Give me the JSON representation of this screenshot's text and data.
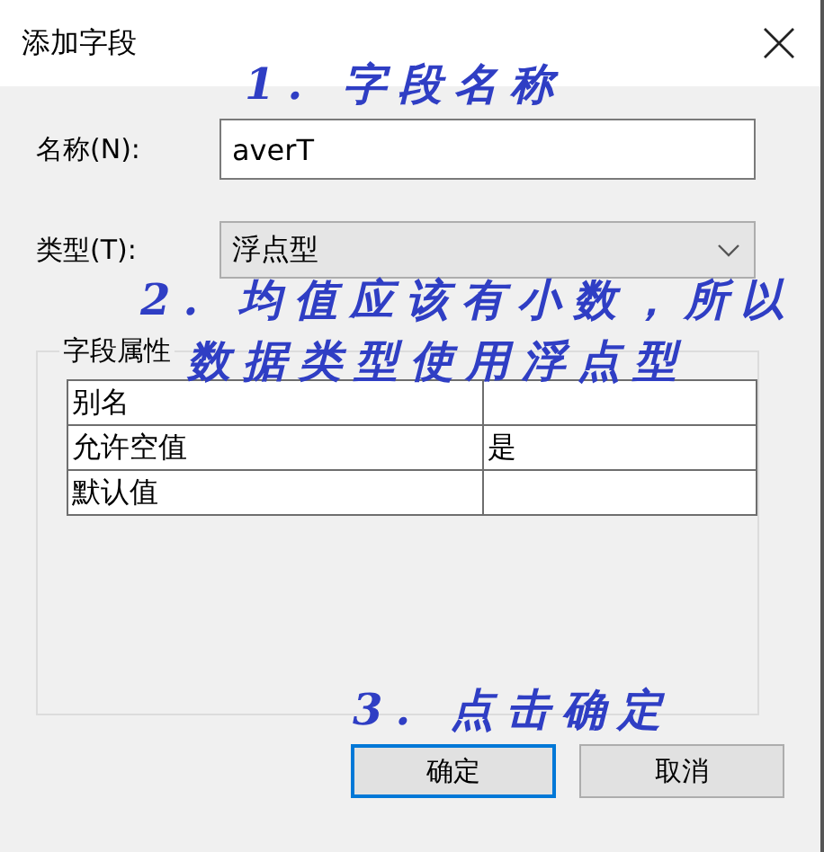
{
  "window": {
    "title": "添加字段"
  },
  "fields": [
    {
      "kind": "text",
      "label": "名称(N):",
      "value": "averT"
    },
    {
      "kind": "dropdown",
      "label": "类型(T):",
      "value": "浮点型"
    }
  ],
  "group": {
    "title": "字段属性",
    "rows": [
      {
        "name": "别名"
      },
      {
        "name": "允许空值",
        "value": "是"
      },
      {
        "name": "默认值"
      }
    ]
  },
  "buttons": [
    {
      "label": "确定",
      "default": true
    },
    {
      "label": "取消",
      "default": false
    }
  ],
  "annotations": [
    {
      "lines": [
        "1. 字段名称"
      ]
    },
    {
      "lines": [
        "2. 均值应该有小数，所以",
        "数据类型使用浮点型"
      ]
    },
    {
      "lines": [
        "3. 点击确定"
      ]
    }
  ]
}
